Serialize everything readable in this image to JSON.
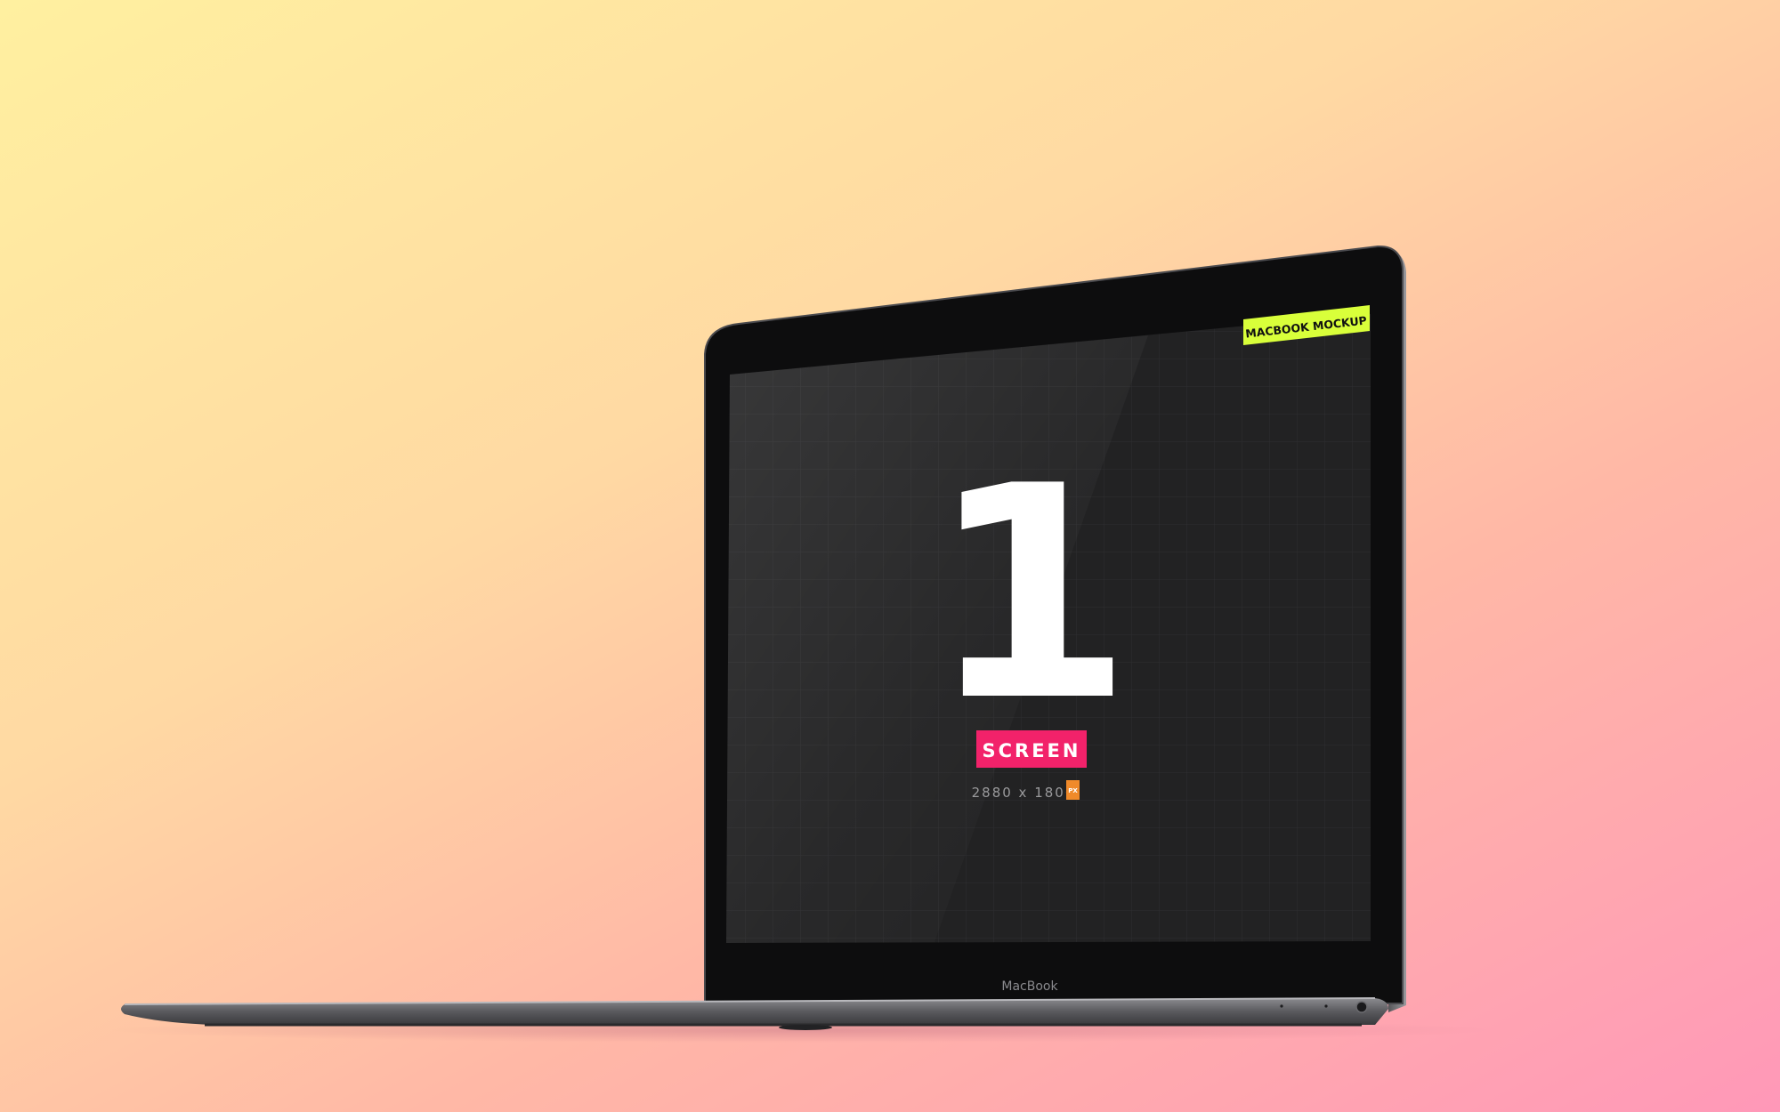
{
  "badge": {
    "text": "MACBOOK MOCKUP",
    "color": "#d9ff3a"
  },
  "screen": {
    "number": "1",
    "label": "SCREEN",
    "label_color": "#f2226a",
    "resolution": "2880 x 1800",
    "unit": "PX",
    "unit_color": "#f08a2a"
  },
  "laptop": {
    "brand": "MacBook"
  },
  "background": {
    "gradient_start": "#fff0a0",
    "gradient_end": "#ff98b8"
  }
}
